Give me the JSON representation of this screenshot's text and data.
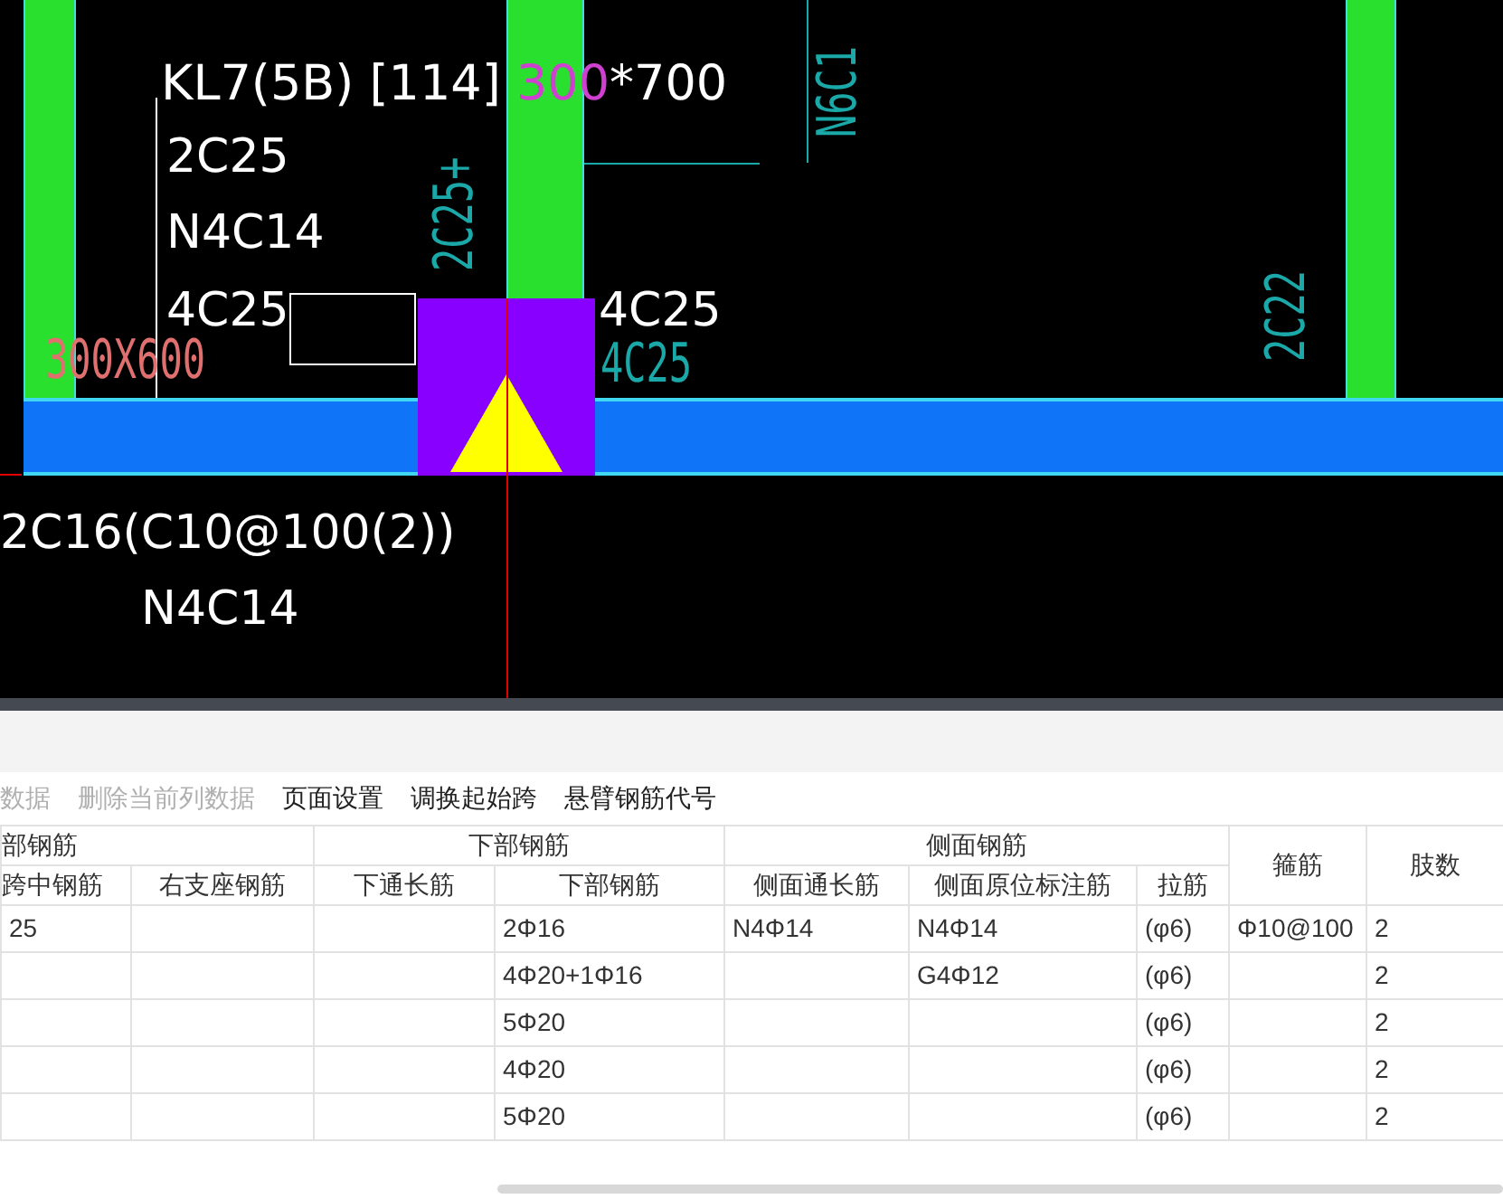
{
  "drawing": {
    "beam_label": [
      {
        "text": "KL7(5B) [114] ",
        "highlight": false
      },
      {
        "text": "300",
        "highlight": true
      },
      {
        "text": "*700",
        "highlight": false
      }
    ],
    "annotations": [
      {
        "text": "2C25+",
        "kind": "teal-vertical"
      },
      {
        "text": "N6C1",
        "kind": "teal-vertical"
      },
      {
        "text": "2C25",
        "kind": "white"
      },
      {
        "text": "N4C14",
        "kind": "white"
      },
      {
        "text": "2C22",
        "kind": "teal-vertical"
      },
      {
        "text": "4C25",
        "kind": "white"
      },
      {
        "text": "4C25",
        "kind": "white"
      },
      {
        "text": "4C25",
        "kind": "teal"
      },
      {
        "text": "300X600",
        "kind": "pink"
      },
      {
        "text": "2C16(C10@100(2))",
        "kind": "white"
      },
      {
        "text": "N4C14",
        "kind": "white"
      }
    ]
  },
  "toolbar": [
    {
      "label": "数据",
      "disabled": true
    },
    {
      "label": "删除当前列数据",
      "disabled": true
    },
    {
      "label": "页面设置",
      "disabled": false
    },
    {
      "label": "调换起始跨",
      "disabled": false
    },
    {
      "label": "悬臂钢筋代号",
      "disabled": false
    }
  ],
  "table": {
    "groups": [
      {
        "label": "部钢筋",
        "tall": false
      },
      {
        "label": "下部钢筋",
        "tall": false
      },
      {
        "label": "侧面钢筋",
        "tall": false
      },
      {
        "label": "箍筋",
        "tall": true
      },
      {
        "label": "肢数",
        "tall": true
      }
    ],
    "columns": [
      "跨中钢筋",
      "右支座钢筋",
      "下通长筋",
      "下部钢筋",
      "侧面通长筋",
      "侧面原位标注筋",
      "拉筋"
    ],
    "rows": [
      [
        "25",
        "",
        "",
        "2Φ16",
        "N4Φ14",
        "N4Φ14",
        "(φ6)",
        "Φ10@100",
        "2"
      ],
      [
        "",
        "",
        "",
        "4Φ20+1Φ16",
        "",
        "G4Φ12",
        "(φ6)",
        "",
        "2"
      ],
      [
        "",
        "",
        "",
        "5Φ20",
        "",
        "",
        "(φ6)",
        "",
        "2"
      ],
      [
        "",
        "",
        "",
        "4Φ20",
        "",
        "",
        "(φ6)",
        "",
        "2"
      ],
      [
        "",
        "",
        "",
        "5Φ20",
        "",
        "",
        "(φ6)",
        "",
        "2"
      ]
    ]
  }
}
